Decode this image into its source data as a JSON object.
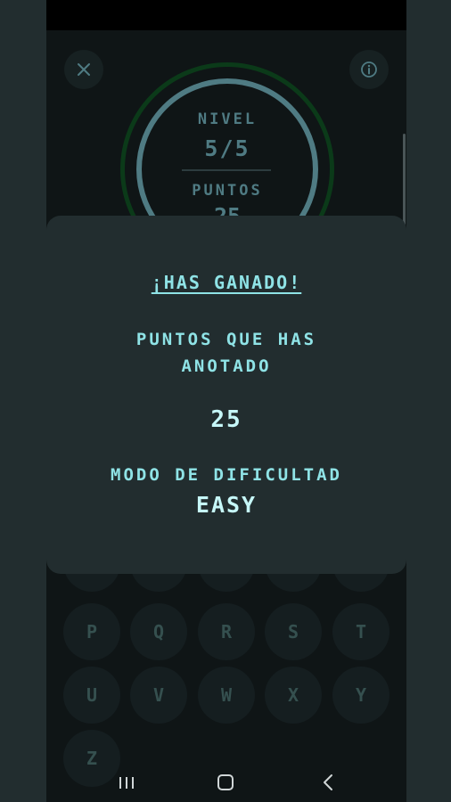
{
  "header": {
    "close_icon": "close-icon",
    "info_icon": "info-icon"
  },
  "level": {
    "label": "NIVEL",
    "value": "5/5"
  },
  "points": {
    "label": "PUNTOS",
    "value": "25"
  },
  "keyboard": {
    "row4": [
      "P",
      "Q",
      "R",
      "S",
      "T"
    ],
    "row5": [
      "U",
      "V",
      "W",
      "X",
      "Y"
    ],
    "row6": [
      "Z"
    ]
  },
  "dialog": {
    "title": "¡HAS GANADO!",
    "points_label_line1": "PUNTOS QUE HAS",
    "points_label_line2": "ANOTADO",
    "score": "25",
    "mode_label": "MODO DE DIFICULTAD",
    "mode_value": "EASY"
  },
  "navbar": {
    "recents_icon": "recents-icon",
    "home_icon": "home-icon",
    "back_icon": "back-icon"
  },
  "colors": {
    "accent": "#8fe3e6",
    "ring": "#4f7b83",
    "ring_outer": "#0b3a19",
    "dialog_bg": "#222d2f"
  }
}
